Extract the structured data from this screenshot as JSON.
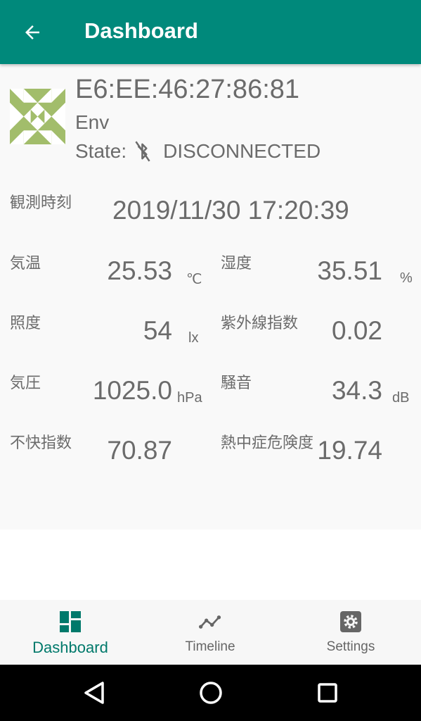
{
  "appbar": {
    "title": "Dashboard",
    "back_icon": "arrow-back-icon"
  },
  "device": {
    "address": "E6:EE:46:27:86:81",
    "type": "Env",
    "state_label": "State:",
    "state_value": "DISCONNECTED",
    "state_icon": "bluetooth-disabled-icon"
  },
  "observation": {
    "label": "観測時刻",
    "value": "2019/11/30 17:20:39"
  },
  "readings": {
    "temperature": {
      "label": "気温",
      "value": "25.53",
      "unit": "℃"
    },
    "humidity": {
      "label": "湿度",
      "value": "35.51",
      "unit": "%"
    },
    "illuminance": {
      "label": "照度",
      "value": "54",
      "unit": "lx"
    },
    "uv_index": {
      "label": "紫外線指数",
      "value": "0.02",
      "unit": ""
    },
    "pressure": {
      "label": "気圧",
      "value": "1025.0",
      "unit": "hPa"
    },
    "noise": {
      "label": "騒音",
      "value": "34.3",
      "unit": "dB"
    },
    "discomfort_index": {
      "label": "不快指数",
      "value": "70.87",
      "unit": ""
    },
    "heatstroke_risk": {
      "label": "熱中症危険度",
      "value": "19.74",
      "unit": ""
    }
  },
  "bottom_nav": {
    "items": [
      {
        "label": "Dashboard",
        "icon": "dashboard-icon",
        "active": true
      },
      {
        "label": "Timeline",
        "icon": "timeline-icon",
        "active": false
      },
      {
        "label": "Settings",
        "icon": "settings-icon",
        "active": false
      }
    ]
  },
  "system_nav": {
    "back_icon": "nav-back-icon",
    "home_icon": "nav-home-icon",
    "recents_icon": "nav-recents-icon"
  },
  "colors": {
    "primary": "#00897b",
    "active_nav": "#00796b",
    "identicon": "#a2bd6b",
    "text_gray": "#6b6b6b"
  }
}
